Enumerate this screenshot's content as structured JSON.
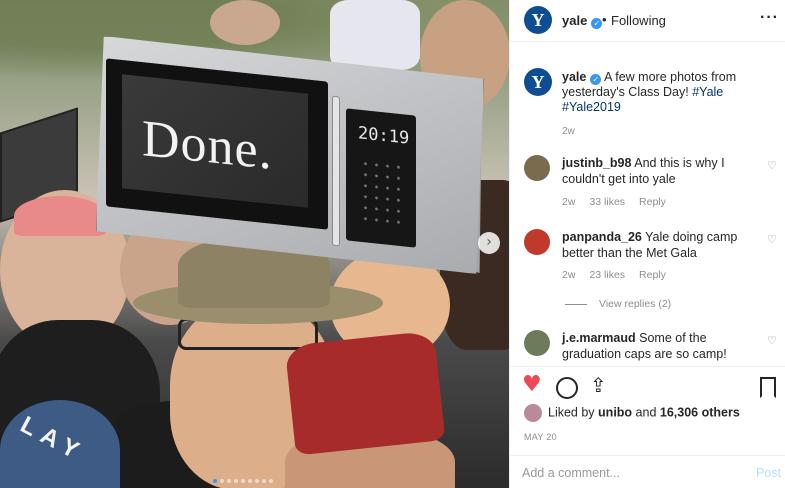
{
  "post": {
    "photo": {
      "microwave_text": "Done.",
      "microwave_clock": "20:19",
      "cap_letters": "LAY",
      "carousel_next": "›",
      "carousel_dots": 9,
      "active_dot": 0
    },
    "header": {
      "avatar_letter": "Y",
      "username": "yale",
      "verified_mark": "✓",
      "separator": "•",
      "follow_status": "Following",
      "more_icon": "···"
    },
    "caption": {
      "avatar_letter": "Y",
      "username": "yale",
      "text": "A few more photos from yesterday's Class Day!",
      "hashtags": [
        "#Yale",
        "#Yale2019"
      ],
      "time": "2w"
    },
    "comments": [
      {
        "username": "justinb_b98",
        "text": "And this is why I couldn't get into yale",
        "time": "2w",
        "likes": "33 likes",
        "reply": "Reply",
        "avatar_color": "#7a6b4f"
      },
      {
        "username": "panpanda_26",
        "text": "Yale doing camp better than the Met Gala",
        "time": "2w",
        "likes": "23 likes",
        "reply": "Reply",
        "avatar_color": "#c0392b",
        "view_replies": "View replies (2)"
      },
      {
        "username": "j.e.marmaud",
        "text": "Some of the graduation caps are so camp!",
        "avatar_color": "#6d7b5a"
      }
    ],
    "likes": {
      "prefix": "Liked by",
      "user": "unibo",
      "suffix": "and",
      "count": "16,306 others"
    },
    "date": "MAY 20",
    "comment_box": {
      "placeholder": "Add a comment...",
      "post_label": "Post"
    },
    "icons": {
      "like": "heart-icon",
      "comment": "comment-icon",
      "share": "share-icon",
      "save": "bookmark-icon"
    },
    "colors": {
      "brand": "#0f4d92",
      "verified": "#3897f0",
      "liked_heart": "#ed4956",
      "hashtag": "#003569",
      "post_disabled": "#b2dffc"
    }
  }
}
